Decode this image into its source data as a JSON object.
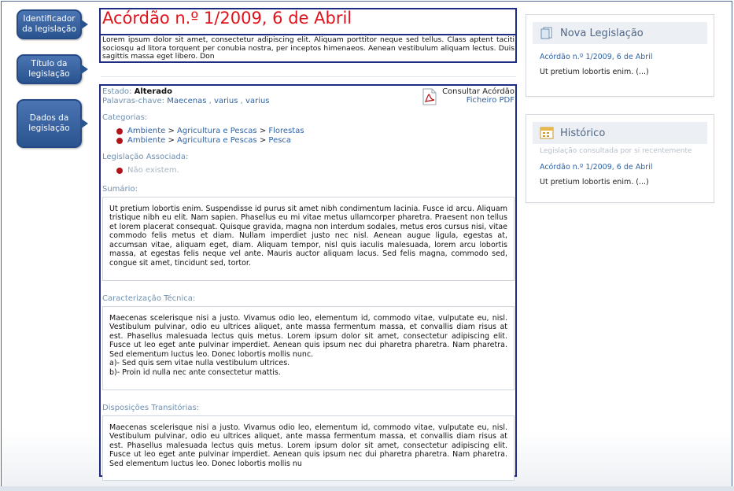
{
  "callouts": {
    "identifier": "Identificador da legislação",
    "title": "Título da legislação",
    "data": "Dados da legislação"
  },
  "document": {
    "title": "Acórdão n.º 1/2009, 6 de Abril",
    "summary": "Lorem ipsum dolor sit amet, consectetur adipiscing elit. Aliquam porttitor neque sed tellus. Class aptent taciti sociosqu ad litora torquent per conubia nostra, per inceptos himenaeos. Aenean vestibulum aliquam lectus. Duis sagittis massa eget libero. Don"
  },
  "meta": {
    "status_label": "Estado:",
    "status_value": "Alterado",
    "keywords_label": "Palavras-chave:",
    "keywords": [
      "Maecenas",
      "varius",
      "varius"
    ],
    "keyword_sep": ",",
    "pdf_label": "Consultar Acórdão",
    "pdf_link": "Ficheiro PDF"
  },
  "categories": {
    "label": "Categorias:",
    "items": [
      {
        "parts": [
          "Ambiente",
          "Agricultura e Pescas",
          "Florestas"
        ]
      },
      {
        "parts": [
          "Ambiente",
          "Agricultura e Pescas",
          "Pesca"
        ]
      }
    ],
    "separator": ">"
  },
  "associated": {
    "label": "Legislação Associada:",
    "empty": "Não existem."
  },
  "sumario": {
    "label": "Sumário:",
    "text": "Ut pretium lobortis enim. Suspendisse id purus sit amet nibh condimentum lacinia. Fusce id arcu. Aliquam tristique nibh eu elit. Nam sapien. Phasellus eu mi vitae metus ullamcorper pharetra. Praesent non tellus et lorem placerat consequat. Quisque gravida, magna non interdum sodales, metus eros cursus nisi, vitae commodo felis metus et diam. Nullam imperdiet justo nec nisl. Aenean augue ligula, egestas at, accumsan vitae, aliquam eget, diam. Aliquam tempor, nisl quis iaculis malesuada, lorem arcu lobortis massa, at egestas felis neque vel ante. Mauris auctor aliquam lacus. Sed felis magna, commodo sed, congue sit amet, tincidunt sed, tortor."
  },
  "caracterizacao": {
    "label": "Caracterização Técnica:",
    "text": "Maecenas scelerisque nisi a justo. Vivamus odio leo, elementum id, commodo vitae, vulputate eu, nisl. Vestibulum pulvinar, odio eu ultrices aliquet, ante massa fermentum massa, et convallis diam risus at est. Phasellus malesuada lectus quis metus. Lorem ipsum dolor sit amet, consectetur adipiscing elit. Fusce ut leo eget ante pulvinar imperdiet. Aenean quis ipsum nec dui pharetra pharetra. Nam pharetra. Sed elementum luctus leo. Donec lobortis mollis nunc.",
    "line_a": "a)- Sed quis sem vitae nulla vestibulum ultrices.",
    "line_b": "b)- Proin id nulla nec ante consectetur mattis."
  },
  "disposicoes": {
    "label": "Disposições Transitórias:",
    "text": "Maecenas scelerisque nisi a justo. Vivamus odio leo, elementum id, commodo vitae, vulputate eu, nisl. Vestibulum pulvinar, odio eu ultrices aliquet, ante massa fermentum massa, et convallis diam risus at est. Phasellus malesuada lectus quis metus. Lorem ipsum dolor sit amet, consectetur adipiscing elit. Fusce ut leo eget ante pulvinar imperdiet. Aenean quis ipsum nec dui pharetra pharetra. Nam pharetra. Sed elementum luctus leo. Donec lobortis mollis nu"
  },
  "sidebar": {
    "nova": {
      "title": "Nova Legislação",
      "icon": "documents-icon",
      "link": "Acórdão n.º 1/2009, 6 de Abril",
      "text": "Ut pretium lobortis enim. (...)"
    },
    "historico": {
      "title": "Histórico",
      "icon": "calendar-icon",
      "subtitle": "Legislação consultada por si recentemente",
      "link": "Acórdão n.º 1/2009, 6 de Abril",
      "text": "Ut pretium lobortis enim. (...)"
    }
  },
  "colors": {
    "title_red": "#e0121b",
    "link_blue": "#2e63a6",
    "highlight_border": "#1f2c80",
    "callout_blue": "#2a548f",
    "bullet_red": "#b0141a"
  }
}
